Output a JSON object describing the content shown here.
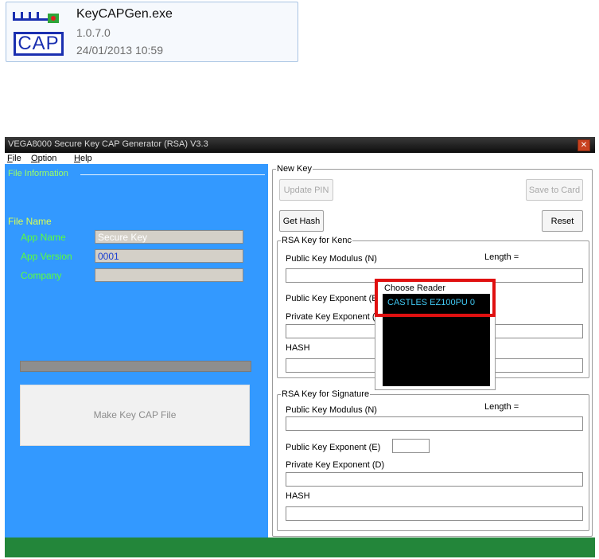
{
  "file_tile": {
    "name": "KeyCAPGen.exe",
    "version": "1.0.7.0",
    "date": "24/01/2013 10:59",
    "icon": "CAP"
  },
  "window": {
    "title": "VEGA8000 Secure Key CAP Generator (RSA) V3.3",
    "menu": [
      {
        "label": "File",
        "accel": "F",
        "rest": "ile"
      },
      {
        "label": "Option",
        "accel": "O",
        "rest": "ption"
      },
      {
        "label": "Help",
        "accel": "H",
        "rest": "elp"
      }
    ]
  },
  "left_panel": {
    "group_label": "File Information",
    "file_name_label": "File Name",
    "app_name_label": "App Name",
    "app_name_value": "Secure Key",
    "app_version_label": "App Version",
    "app_version_value": "0001",
    "company_label": "Company",
    "company_value": "",
    "make_button": "Make Key CAP File"
  },
  "right_panel": {
    "group_label": "New Key",
    "update_pin": "Update PIN",
    "save_to_card": "Save to Card",
    "get_hash": "Get Hash",
    "reset": "Reset",
    "kenc": {
      "label": "RSA Key for Kenc",
      "modulus": "Public Key Modulus (N)",
      "length": "Length =",
      "exponent": "Public Key Exponent (E)",
      "private": "Private Key Exponent (D)",
      "hash": "HASH"
    },
    "signature": {
      "label": "RSA Key for Signature",
      "modulus": "Public Key Modulus (N)",
      "length": "Length =",
      "exponent": "Public Key Exponent (E)",
      "private": "Private Key Exponent (D)",
      "hash": "HASH"
    }
  },
  "reader_popup": {
    "label": "Choose Reader",
    "items": [
      "CASTLES EZ100PU 0"
    ]
  },
  "colors": {
    "left_panel_bg": "#3399ff",
    "status_bar": "#23863a",
    "highlight": "#e01010"
  }
}
